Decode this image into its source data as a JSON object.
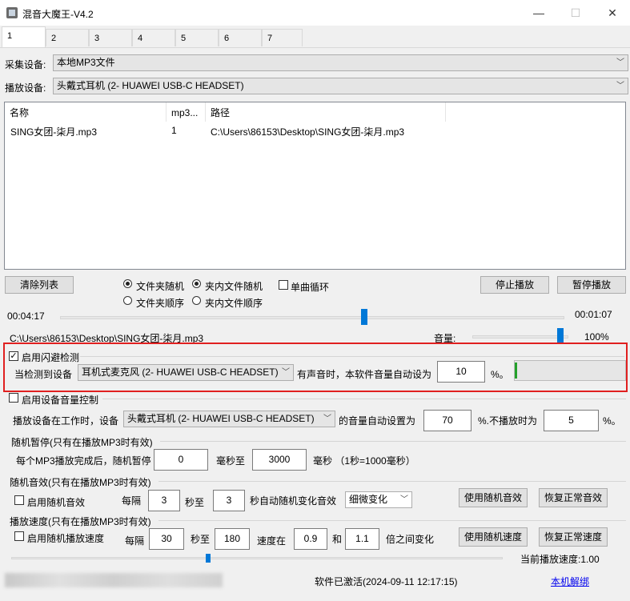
{
  "window": {
    "title": "混音大魔王-V4.2",
    "minimize": "—",
    "maximize": "☐",
    "close": "✕"
  },
  "tabs": [
    "1",
    "2",
    "3",
    "4",
    "5",
    "6",
    "7"
  ],
  "capture": {
    "label": "采集设备:",
    "value": "本地MP3文件"
  },
  "playback": {
    "label": "播放设备:",
    "value": "头戴式耳机 (2- HUAWEI USB-C HEADSET)"
  },
  "list": {
    "columns": [
      "名称",
      "mp3...",
      "路径"
    ],
    "rows": [
      {
        "name": "SING女团-柒月.mp3",
        "num": "1",
        "path": "C:\\Users\\86153\\Desktop\\SING女团-柒月.mp3"
      }
    ]
  },
  "controls": {
    "clear": "清除列表",
    "radio_folder_random": "文件夹随机",
    "radio_infolder_random": "夹内文件随机",
    "radio_folder_order": "文件夹顺序",
    "radio_infolder_order": "夹内文件顺序",
    "single_loop": "单曲循环",
    "stop": "停止播放",
    "pause": "暂停播放"
  },
  "progress": {
    "elapsed": "00:04:17",
    "remaining": "00:01:07",
    "position": 0.605
  },
  "now_playing": {
    "path": "C:\\Users\\86153\\Desktop\\SING女团-柒月.mp3",
    "volume_label": "音量:",
    "volume": "100%",
    "volume_value": 1.0
  },
  "dodge": {
    "enable": "启用闪避检测",
    "when_device": "当检测到设备",
    "device": "耳机式麦克风 (2- HUAWEI USB-C HEADSET)",
    "set_text": "有声音时，本软件音量自动设为",
    "value": "10",
    "unit": "%。",
    "level": 0.02
  },
  "device_volume": {
    "enable": "启用设备音量控制",
    "prefix": "播放设备在工作时，设备",
    "device": "头戴式耳机 (2- HUAWEI USB-C HEADSET)",
    "set_to": "的音量自动设置为",
    "working_value": "70",
    "not_playing": "%.不播放时为",
    "idle_value": "5",
    "unit": "%。"
  },
  "random_pause": {
    "title": "随机暂停(只有在播放MP3时有效)",
    "prefix": "每个MP3播放完成后，随机暂停",
    "min": "0",
    "to": "毫秒至",
    "max": "3000",
    "suffix": "毫秒 （1秒=1000毫秒）"
  },
  "random_effect": {
    "title": "随机音效(只有在播放MP3时有效)",
    "enable": "启用随机音效",
    "every": "每隔",
    "min": "3",
    "to": "秒至",
    "max": "3",
    "change": "秒自动随机变化音效",
    "mode": "细微变化",
    "use": "使用随机音效",
    "restore": "恢复正常音效"
  },
  "speed": {
    "title": "播放速度(只有在播放MP3时有效)",
    "enable": "启用随机播放速度",
    "every": "每隔",
    "min": "30",
    "to": "秒至",
    "max": "180",
    "speed_in": "速度在",
    "low": "0.9",
    "and": "和",
    "high": "1.1",
    "between": "倍之间变化",
    "use": "使用随机速度",
    "restore": "恢复正常速度",
    "current": "当前播放速度:1.00",
    "slider": 0.4
  },
  "status": {
    "activated": "软件已激活(2024-09-11 12:17:15)",
    "unbind": "本机解绑"
  }
}
